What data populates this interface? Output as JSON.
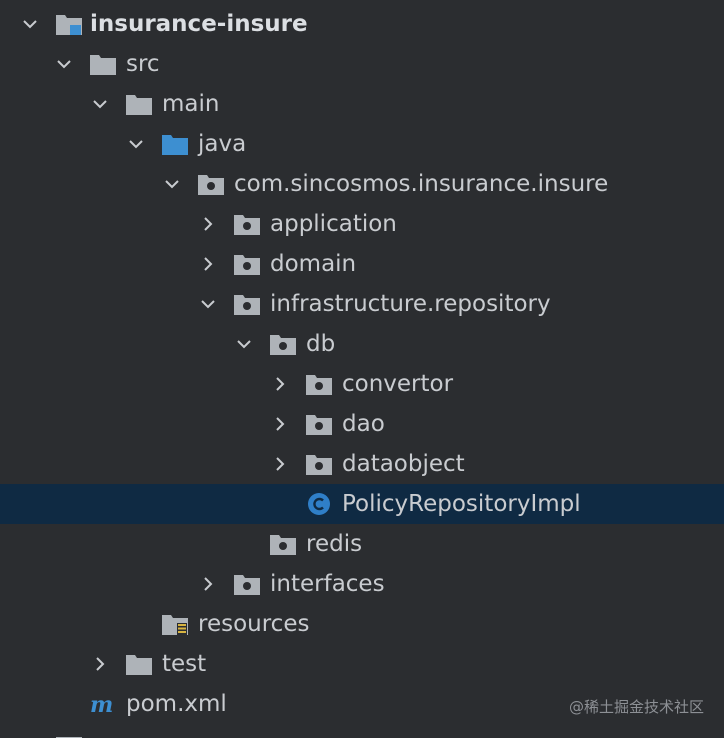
{
  "tree": {
    "project_name": "insurance-insure",
    "src": "src",
    "main": "main",
    "java": "java",
    "package": "com.sincosmos.insurance.insure",
    "application": "application",
    "domain": "domain",
    "infrastructure": "infrastructure.repository",
    "db": "db",
    "convertor": "convertor",
    "dao": "dao",
    "dataobject": "dataobject",
    "policy_impl": "PolicyRepositoryImpl",
    "redis": "redis",
    "interfaces": "interfaces",
    "resources": "resources",
    "test": "test",
    "pom": "pom.xml"
  },
  "watermark": "@稀土掘金技术社区",
  "icons": {
    "expanded": "chevron-down-icon",
    "collapsed": "chevron-right-icon",
    "module": "module-folder-icon",
    "folder": "folder-icon",
    "source_root": "source-root-folder-icon",
    "package": "package-icon",
    "class": "class-icon",
    "resources": "resources-folder-icon",
    "maven": "maven-icon"
  },
  "colors": {
    "background": "#2b2d30",
    "selection": "#0f2a43",
    "folder": "#aeb3b8",
    "source_root": "#3d8fd1",
    "class_icon": "#2f7fc8",
    "text": "#c9ccd0"
  }
}
